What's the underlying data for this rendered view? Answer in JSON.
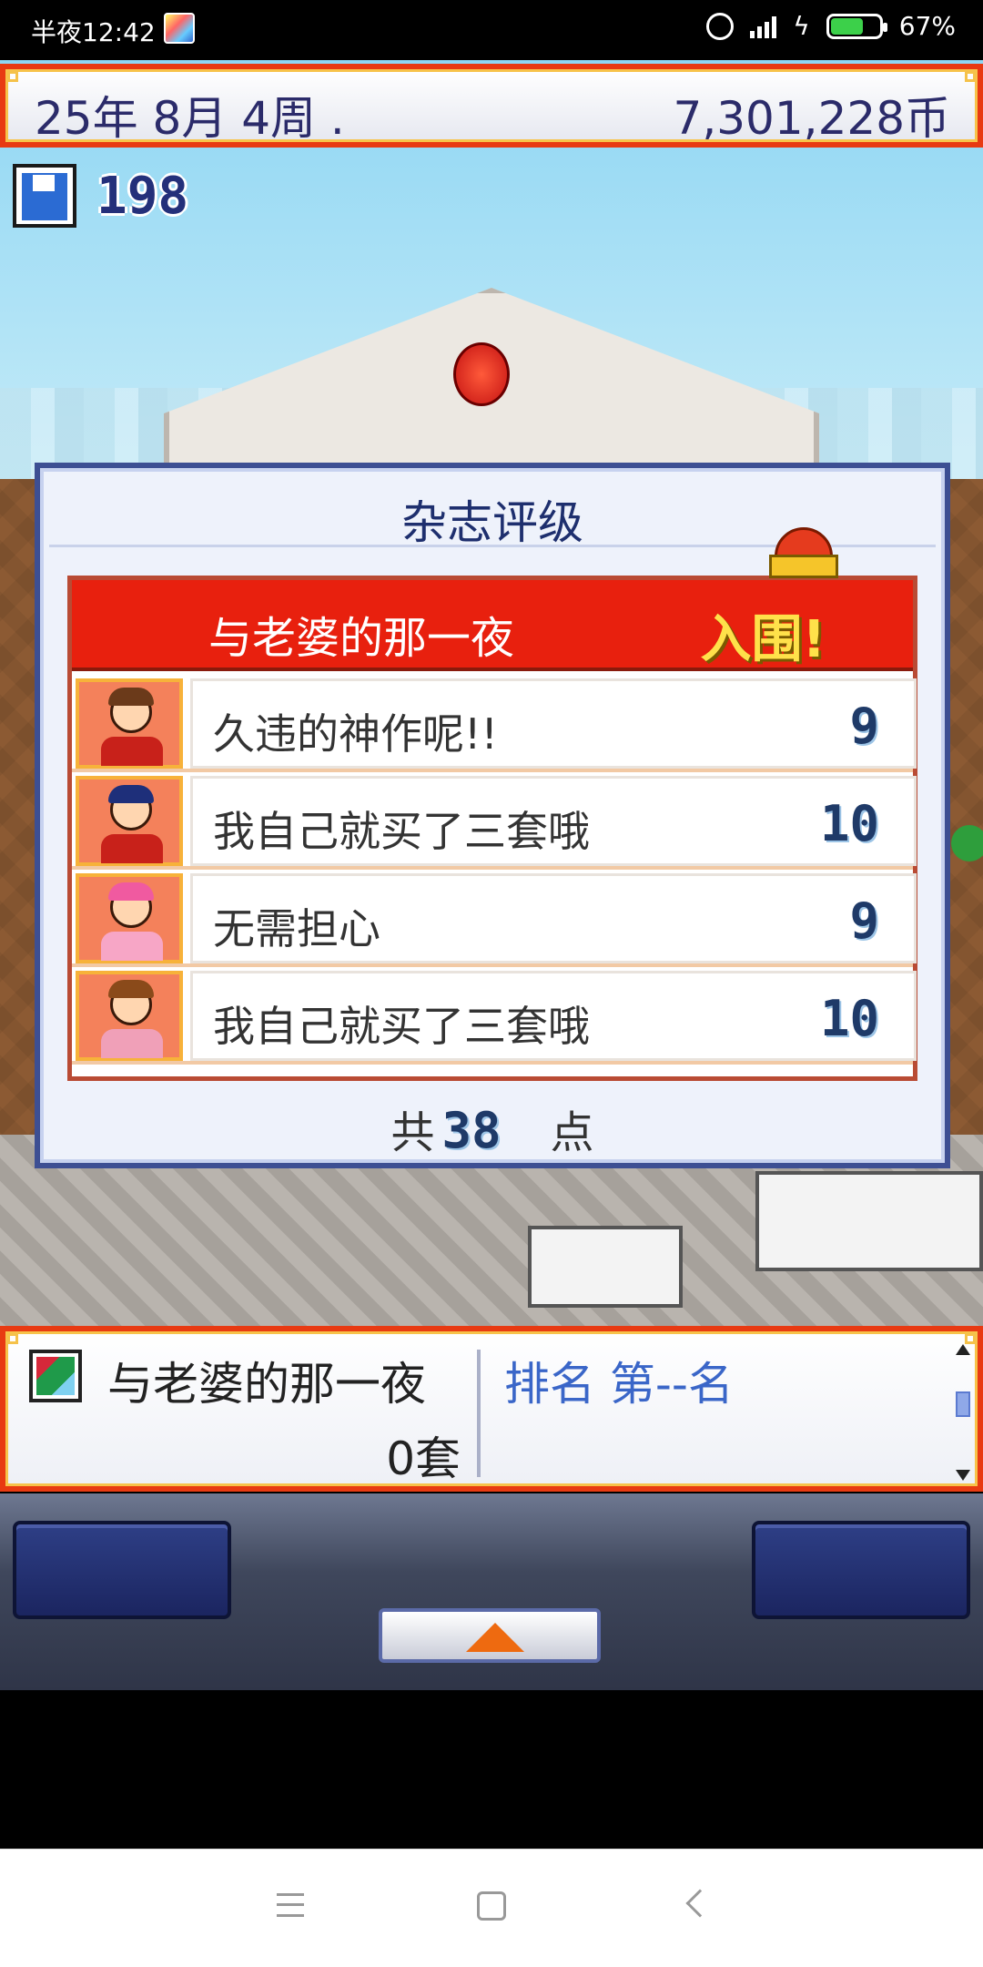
{
  "status_bar": {
    "time": "半夜12:42",
    "battery": "67%",
    "battery_level": 0.67
  },
  "top_bar": {
    "date": "25年 8月 4周 .",
    "money": "7,301,228币"
  },
  "save": {
    "icon": "floppy-disk-icon",
    "count": "198"
  },
  "dialog": {
    "title": "杂志评级",
    "game_title": "与老婆的那一夜",
    "result": "入围!",
    "reviews": [
      {
        "comment": "久违的神作呢!!",
        "score": "9"
      },
      {
        "comment": "我自己就买了三套哦",
        "score": "10"
      },
      {
        "comment": "无需担心",
        "score": "9"
      },
      {
        "comment": "我自己就买了三套哦",
        "score": "10"
      }
    ],
    "total_prefix": "共",
    "total_value": "38",
    "total_unit": "点"
  },
  "info_panel": {
    "game_title": "与老婆的那一夜",
    "sales": "0套",
    "rank": "排名 第--名"
  },
  "colors": {
    "accent_red": "#e8200e",
    "frame_orange": "#e83a12",
    "title_navy": "#1e2f6e",
    "rank_blue": "#3a66c8"
  }
}
